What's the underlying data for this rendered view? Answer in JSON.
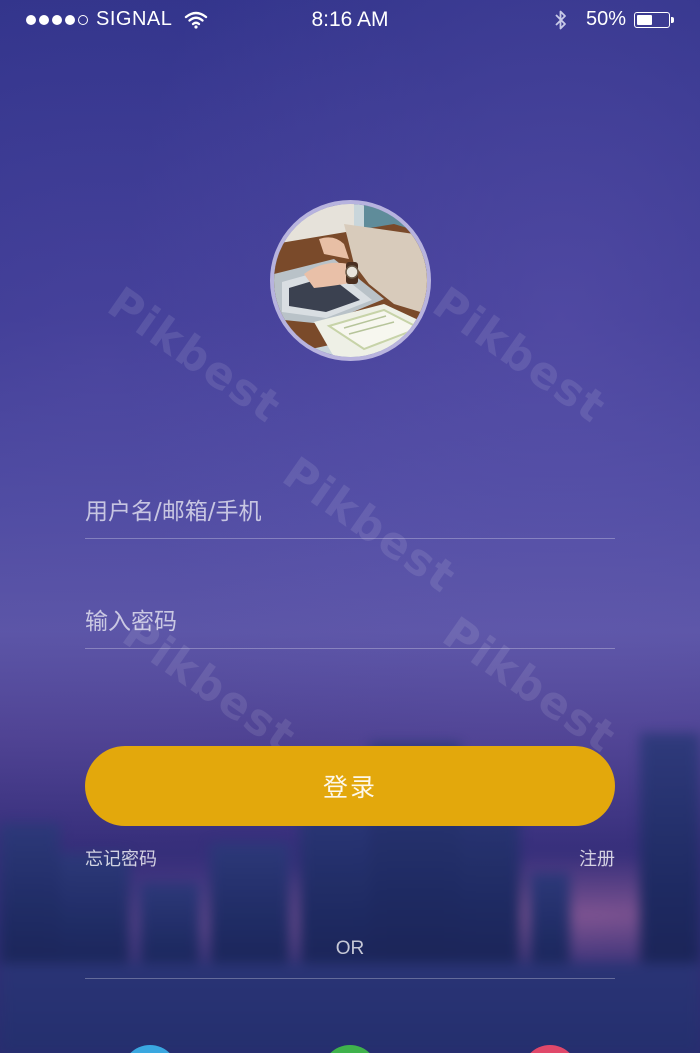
{
  "status_bar": {
    "carrier": "SIGNAL",
    "time": "8:16 AM",
    "battery_percent": "50%",
    "battery_level": 0.5,
    "signal_bars_filled": 4,
    "signal_bars_total": 5
  },
  "avatar": {
    "description_icon": "avatar-photo"
  },
  "form": {
    "username_placeholder": "用户名/邮箱/手机",
    "password_placeholder": "输入密码",
    "login_label": "登录",
    "forgot_label": "忘记密码",
    "register_label": "注册",
    "or_label": "OR"
  },
  "social_buttons": [
    {
      "color": "#3aa7e0"
    },
    {
      "color": "#3fb24c"
    },
    {
      "color": "#e0486a"
    }
  ],
  "watermark": "Pikbest",
  "colors": {
    "accent": "#e3a80c",
    "background_top": "#30338a"
  }
}
